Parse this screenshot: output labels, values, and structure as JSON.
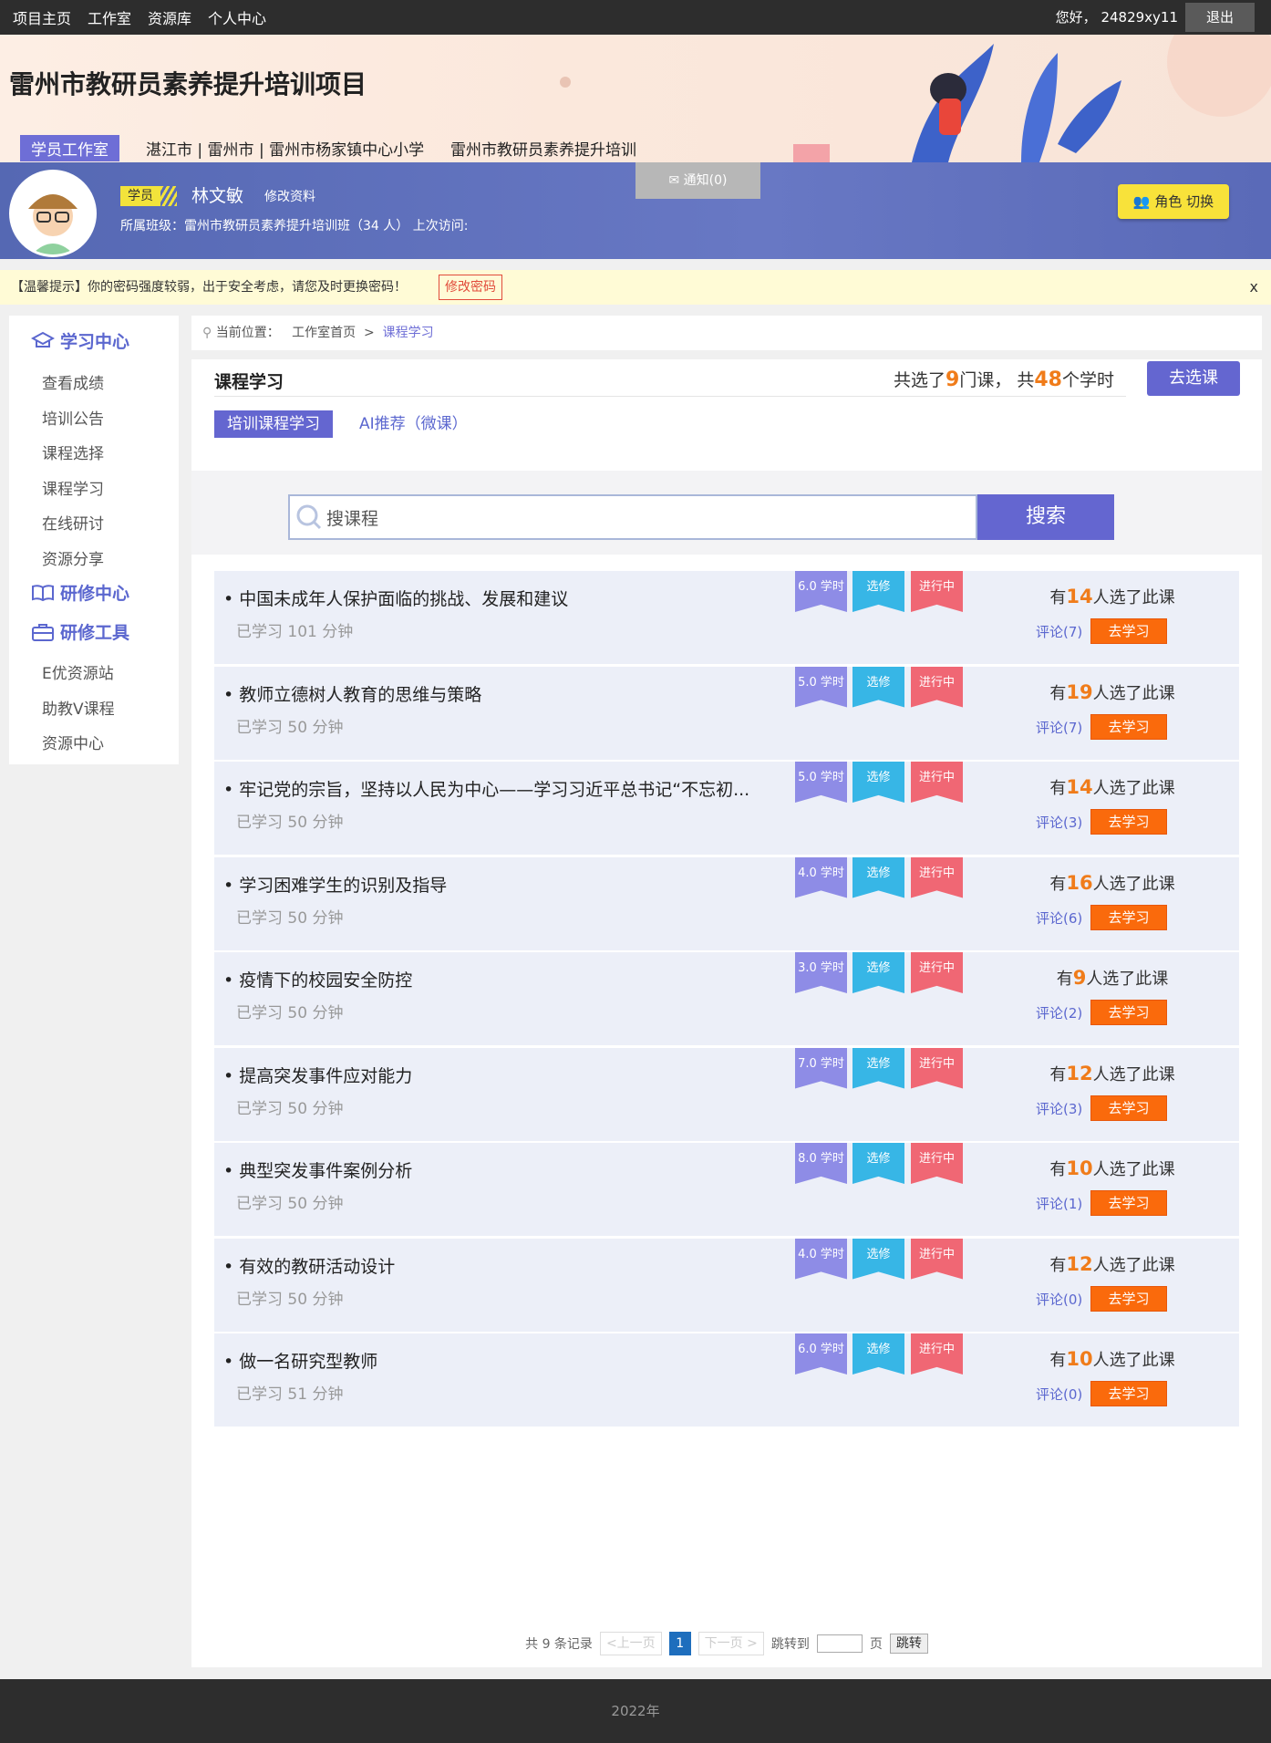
{
  "topbar": {
    "nav": [
      "项目主页",
      "工作室",
      "资源库",
      "个人中心"
    ],
    "greeting": "您好， 24829xy11",
    "logout": "退出"
  },
  "banner": {
    "title": "雷州市教研员素养提升培训项目",
    "tag": "学员工作室",
    "crumb": "湛江市 | 雷州市 | 雷州市杨家镇中心小学",
    "crumb_project": "雷州市教研员素养提升培训"
  },
  "profile": {
    "role": "学员",
    "name": "林文敏",
    "edit": "修改资料",
    "class_info": "所属班级：雷州市教研员素养提升培训班（34 人）  上次访问:",
    "notice": "通知(0)",
    "switch": "角色 切换"
  },
  "alert": {
    "text": "【温馨提示】你的密码强度较弱，出于安全考虑，请您及时更换密码！",
    "button": "修改密码",
    "close": "x"
  },
  "sidebar": {
    "head1": "学习中心",
    "items1": [
      "查看成绩",
      "培训公告",
      "课程选择",
      "课程学习",
      "在线研讨",
      "资源分享"
    ],
    "head2": "研修中心",
    "head3": "研修工具",
    "items3": [
      "E优资源站",
      "助教V课程",
      "资源中心"
    ]
  },
  "breadcrumb": {
    "label": "当前位置：",
    "home": "工作室首页",
    "sep": ">",
    "current": "课程学习"
  },
  "section": {
    "title": "课程学习",
    "summary_pre": "共选了",
    "summary_courses": "9",
    "summary_mid": "门课， 共",
    "summary_hours": "48",
    "summary_post": "个学时",
    "choose": "去选课",
    "tab1": "培训课程学习",
    "tab2": "AI推荐（微课）"
  },
  "search": {
    "placeholder": "搜课程",
    "button": "搜索"
  },
  "labels": {
    "elective": "选修",
    "status": "进行中",
    "sel_pre": "有",
    "sel_post": "人选了此课",
    "go": "去学习"
  },
  "courses": [
    {
      "title": "• 中国未成年人保护面临的挑战、发展和建议",
      "progress": "已学习 101 分钟",
      "hours": "6.0 学时",
      "count": "14",
      "comments": "评论(7)"
    },
    {
      "title": "• 教师立德树人教育的思维与策略",
      "progress": "已学习 50 分钟",
      "hours": "5.0 学时",
      "count": "19",
      "comments": "评论(7)"
    },
    {
      "title": "• 牢记党的宗旨，坚持以人民为中心——学习习近平总书记“不忘初...",
      "progress": "已学习 50 分钟",
      "hours": "5.0 学时",
      "count": "14",
      "comments": "评论(3)"
    },
    {
      "title": "• 学习困难学生的识别及指导",
      "progress": "已学习 50 分钟",
      "hours": "4.0 学时",
      "count": "16",
      "comments": "评论(6)"
    },
    {
      "title": "• 疫情下的校园安全防控",
      "progress": "已学习 50 分钟",
      "hours": "3.0 学时",
      "count": "9",
      "comments": "评论(2)"
    },
    {
      "title": "• 提高突发事件应对能力",
      "progress": "已学习 50 分钟",
      "hours": "7.0 学时",
      "count": "12",
      "comments": "评论(3)"
    },
    {
      "title": "• 典型突发事件案例分析",
      "progress": "已学习 50 分钟",
      "hours": "8.0 学时",
      "count": "10",
      "comments": "评论(1)"
    },
    {
      "title": "• 有效的教研活动设计",
      "progress": "已学习 50 分钟",
      "hours": "4.0 学时",
      "count": "12",
      "comments": "评论(0)"
    },
    {
      "title": "• 做一名研究型教师",
      "progress": "已学习 51 分钟",
      "hours": "6.0 学时",
      "count": "10",
      "comments": "评论(0)"
    }
  ],
  "pager": {
    "total": "共 9 条记录",
    "prev": "<上一页",
    "page": "1",
    "next": "下一页 >",
    "jump_label": "跳转到",
    "page_unit": "页",
    "jump": "跳转"
  },
  "footer": {
    "text": "2022年"
  }
}
